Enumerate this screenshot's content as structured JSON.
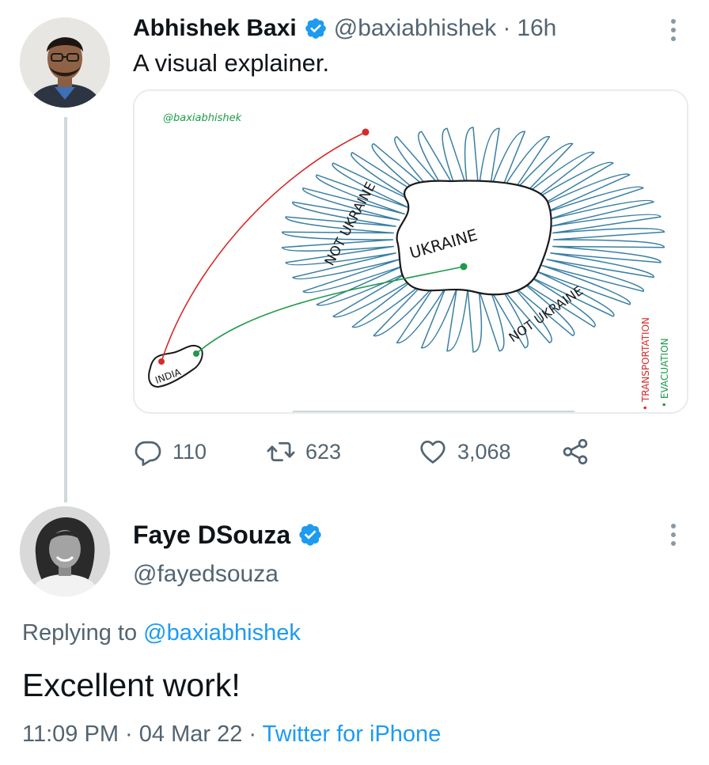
{
  "tweet": {
    "author_name": "Abhishek Baxi",
    "author_handle": "@baxiabhishek",
    "separator": "·",
    "time_ago": "16h",
    "text": "A visual explainer.",
    "media": {
      "watermark": "@baxiabhishek",
      "label_ukraine": "UKRAINE",
      "label_not_ukraine_1": "NOT UKRAINE",
      "label_not_ukraine_2": "NOT UKRAINE",
      "label_india": "INDIA",
      "legend_transportation": "• TRANSPORTATION",
      "legend_evacuation": "• EVACUATION",
      "colors": {
        "scribble": "#3a7fa3",
        "ukraine_outline": "#1a1a1a",
        "transportation": "#d62b2b",
        "evacuation": "#1e9a4a"
      }
    },
    "actions": {
      "replies": "110",
      "retweets": "623",
      "likes": "3,068"
    }
  },
  "reply": {
    "author_name": "Faye DSouza",
    "author_handle": "@fayedsouza",
    "replying_prefix": "Replying to",
    "replying_to": "@baxiabhishek",
    "text": "Excellent work!",
    "time": "11:09 PM",
    "separator": "·",
    "date": "04 Mar 22",
    "source": "Twitter for iPhone"
  },
  "colors": {
    "accent": "#1d9bf0",
    "secondary_text": "#536471",
    "primary_text": "#0f1419"
  },
  "icons": [
    "verified-badge-icon",
    "more-options-icon",
    "reply-icon",
    "retweet-icon",
    "like-icon",
    "share-icon"
  ]
}
